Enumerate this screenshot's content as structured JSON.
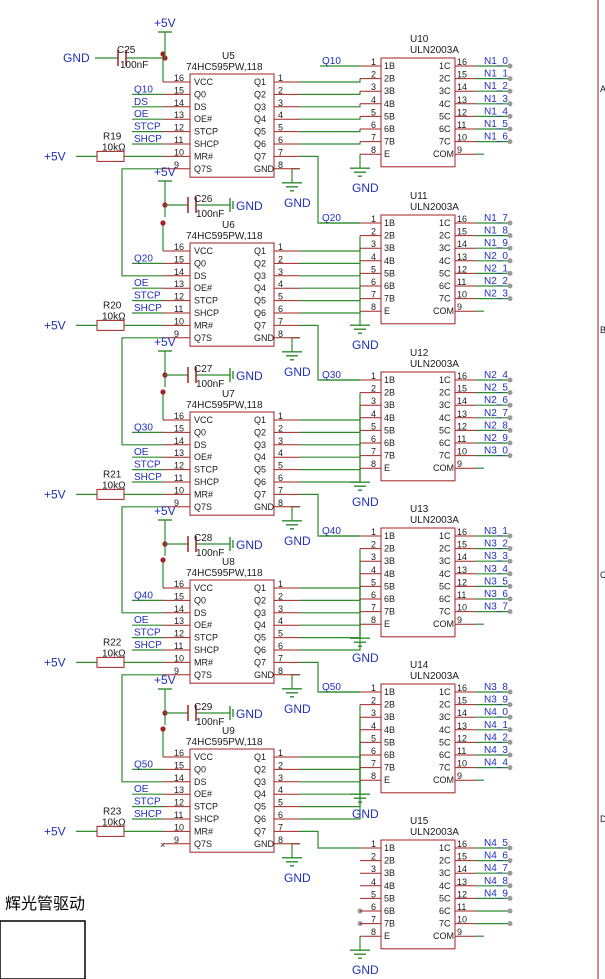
{
  "title": "辉光管驱动",
  "colors": {
    "wire": "#2e8b2e",
    "body": "#a02222",
    "net": "#1f2fbf",
    "pin": "#1a1a1a"
  },
  "power": {
    "vcc": "+5V",
    "gnd": "GND"
  },
  "caps": [
    {
      "ref": "C25",
      "val": "100nF"
    },
    {
      "ref": "C26",
      "val": "100nF"
    },
    {
      "ref": "C27",
      "val": "100nF"
    },
    {
      "ref": "C28",
      "val": "100nF"
    },
    {
      "ref": "C29",
      "val": "100nF"
    }
  ],
  "resistors": [
    {
      "ref": "R19",
      "val": "10kΩ"
    },
    {
      "ref": "R20",
      "val": "10kΩ"
    },
    {
      "ref": "R21",
      "val": "10kΩ"
    },
    {
      "ref": "R22",
      "val": "10kΩ"
    },
    {
      "ref": "R23",
      "val": "10kΩ"
    }
  ],
  "shift_registers": [
    {
      "ref": "U5",
      "part": "74HC595PW,118",
      "q7s_net": "Q10",
      "ds_net": "DS"
    },
    {
      "ref": "U6",
      "part": "74HC595PW,118",
      "q7s_net": "Q20",
      "ds_net": "Q10"
    },
    {
      "ref": "U7",
      "part": "74HC595PW,118",
      "q7s_net": "Q30",
      "ds_net": "Q20"
    },
    {
      "ref": "U8",
      "part": "74HC595PW,118",
      "q7s_net": "Q40",
      "ds_net": "Q30"
    },
    {
      "ref": "U9",
      "part": "74HC595PW,118",
      "q7s_net": "Q50",
      "ds_net": "Q40"
    }
  ],
  "sr_left_pins": [
    {
      "num": "16",
      "name": "VCC"
    },
    {
      "num": "15",
      "name": "Q0"
    },
    {
      "num": "14",
      "name": "DS"
    },
    {
      "num": "13",
      "name": "OE#"
    },
    {
      "num": "12",
      "name": "STCP"
    },
    {
      "num": "11",
      "name": "SHCP"
    },
    {
      "num": "10",
      "name": "MR#"
    },
    {
      "num": "9",
      "name": "Q7S"
    }
  ],
  "sr_right_pins": [
    {
      "num": "1",
      "name": "Q1"
    },
    {
      "num": "2",
      "name": "Q2"
    },
    {
      "num": "3",
      "name": "Q3"
    },
    {
      "num": "4",
      "name": "Q4"
    },
    {
      "num": "5",
      "name": "Q5"
    },
    {
      "num": "6",
      "name": "Q6"
    },
    {
      "num": "7",
      "name": "Q7"
    },
    {
      "num": "8",
      "name": "GND"
    }
  ],
  "sr_net_labels": [
    "OE",
    "STCP",
    "SHCP"
  ],
  "drivers": [
    {
      "ref": "U10",
      "part": "ULN2003A",
      "in_net": "Q10",
      "outs": [
        "N1_0",
        "N1_1",
        "N1_2",
        "N1_3",
        "N1_4",
        "N1_5",
        "N1_6"
      ]
    },
    {
      "ref": "U11",
      "part": "ULN2003A",
      "in_net": "Q20",
      "outs": [
        "N1_7",
        "N1_8",
        "N1_9",
        "N2_0",
        "N2_1",
        "N2_2",
        "N2_3"
      ]
    },
    {
      "ref": "U12",
      "part": "ULN2003A",
      "in_net": "Q30",
      "outs": [
        "N2_4",
        "N2_5",
        "N2_6",
        "N2_7",
        "N2_8",
        "N2_9",
        "N3_0"
      ]
    },
    {
      "ref": "U13",
      "part": "ULN2003A",
      "in_net": "Q40",
      "outs": [
        "N3_1",
        "N3_2",
        "N3_3",
        "N3_4",
        "N3_5",
        "N3_6",
        "N3_7"
      ]
    },
    {
      "ref": "U14",
      "part": "ULN2003A",
      "in_net": "Q50",
      "outs": [
        "N3_8",
        "N3_9",
        "N4_0",
        "N4_1",
        "N4_2",
        "N4_3",
        "N4_4"
      ]
    },
    {
      "ref": "U15",
      "part": "ULN2003A",
      "in_net": "",
      "outs": [
        "N4_5",
        "N4_6",
        "N4_7",
        "N4_8",
        "N4_9",
        "",
        ""
      ]
    }
  ],
  "uln_left_pins": [
    {
      "num": "1",
      "name": "1B"
    },
    {
      "num": "2",
      "name": "2B"
    },
    {
      "num": "3",
      "name": "3B"
    },
    {
      "num": "4",
      "name": "4B"
    },
    {
      "num": "5",
      "name": "5B"
    },
    {
      "num": "6",
      "name": "6B"
    },
    {
      "num": "7",
      "name": "7B"
    },
    {
      "num": "8",
      "name": "E"
    }
  ],
  "uln_right_pins": [
    {
      "num": "16",
      "name": "1C"
    },
    {
      "num": "15",
      "name": "2C"
    },
    {
      "num": "14",
      "name": "3C"
    },
    {
      "num": "13",
      "name": "4C"
    },
    {
      "num": "12",
      "name": "5C"
    },
    {
      "num": "11",
      "name": "6C"
    },
    {
      "num": "10",
      "name": "7C"
    },
    {
      "num": "9",
      "name": "COM"
    }
  ],
  "border_letters": [
    "A",
    "B",
    "C",
    "D"
  ]
}
